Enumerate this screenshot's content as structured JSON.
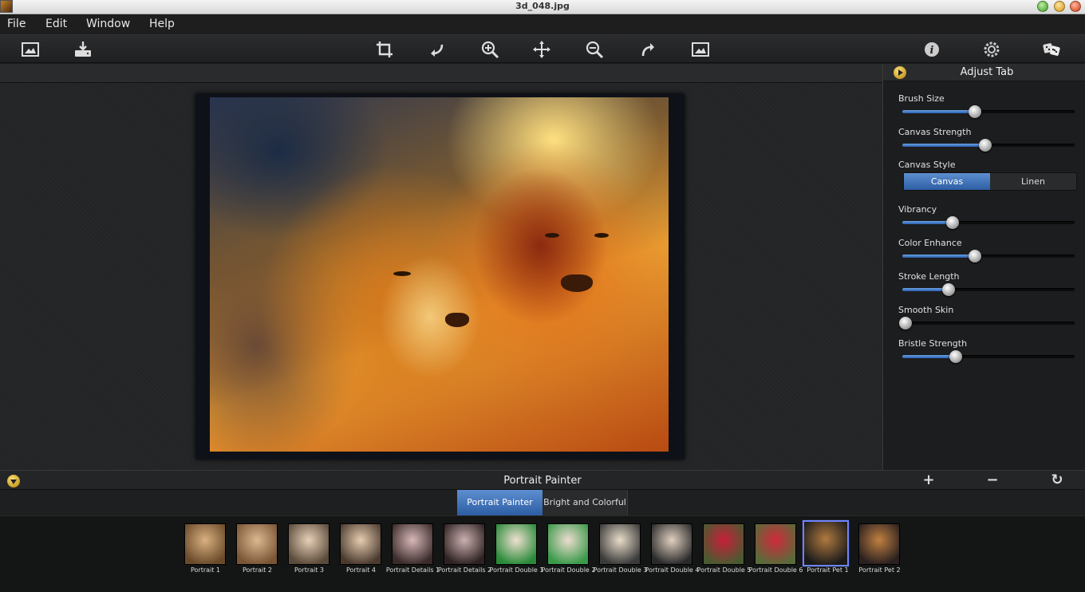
{
  "window": {
    "title": "3d_048.jpg"
  },
  "menu": [
    "File",
    "Edit",
    "Window",
    "Help"
  ],
  "toolbar": {
    "left": [
      "open-image-icon",
      "save-icon"
    ],
    "center": [
      "crop-icon",
      "undo-icon",
      "zoom-in-icon",
      "pan-icon",
      "zoom-out-icon",
      "redo-icon",
      "fit-image-icon"
    ],
    "right": [
      "info-icon",
      "settings-icon",
      "random-dice-icon"
    ]
  },
  "adjust": {
    "title": "Adjust Tab",
    "sliders": [
      {
        "label": "Brush Size",
        "value": 0.42
      },
      {
        "label": "Canvas Strength",
        "value": 0.48
      },
      {
        "label": "Vibrancy",
        "value": 0.29
      },
      {
        "label": "Color Enhance",
        "value": 0.42
      },
      {
        "label": "Stroke Length",
        "value": 0.27
      },
      {
        "label": "Smooth Skin",
        "value": 0.02
      },
      {
        "label": "Bristle Strength",
        "value": 0.31
      }
    ],
    "canvas_style": {
      "label": "Canvas Style",
      "options": [
        "Canvas",
        "Linen"
      ],
      "selected": "Canvas"
    }
  },
  "presets": {
    "title": "Portrait Painter",
    "add_label": "+",
    "remove_label": "−",
    "reset_label": "↻",
    "categories": [
      "Portrait Painter",
      "Bright and Colorful"
    ],
    "selected_category": "Portrait Painter",
    "items": [
      {
        "label": "Portrait 1",
        "tone": [
          "#d9b080",
          "#6a4a2a"
        ]
      },
      {
        "label": "Portrait 2",
        "tone": [
          "#dcb890",
          "#7a5535"
        ]
      },
      {
        "label": "Portrait 3",
        "tone": [
          "#e8d0b8",
          "#5a4a3a"
        ]
      },
      {
        "label": "Portrait 4",
        "tone": [
          "#e6ccb0",
          "#4a3a2e"
        ]
      },
      {
        "label": "Portrait Details 1",
        "tone": [
          "#d8b8b8",
          "#3a2a2a"
        ]
      },
      {
        "label": "Portrait Details 2",
        "tone": [
          "#ccb0b0",
          "#2e2222"
        ]
      },
      {
        "label": "Portrait Double 1",
        "tone": [
          "#f0e0d0",
          "#2a8a3a"
        ]
      },
      {
        "label": "Portrait Double 2",
        "tone": [
          "#eedcd0",
          "#3a9a4a"
        ]
      },
      {
        "label": "Portrait Double 3",
        "tone": [
          "#e8dcc8",
          "#3a3a3a"
        ]
      },
      {
        "label": "Portrait Double 4",
        "tone": [
          "#e0d0c0",
          "#2a2a2a"
        ]
      },
      {
        "label": "Portrait Double 5",
        "tone": [
          "#c8203a",
          "#4a5a30"
        ]
      },
      {
        "label": "Portrait Double 6",
        "tone": [
          "#d02a3a",
          "#5a6a3a"
        ]
      },
      {
        "label": "Portrait Pet 1",
        "tone": [
          "#b07a40",
          "#1a1a1a"
        ]
      },
      {
        "label": "Portrait Pet 2",
        "tone": [
          "#c08040",
          "#2a2020"
        ]
      }
    ],
    "selected_item": "Portrait Pet 1"
  }
}
